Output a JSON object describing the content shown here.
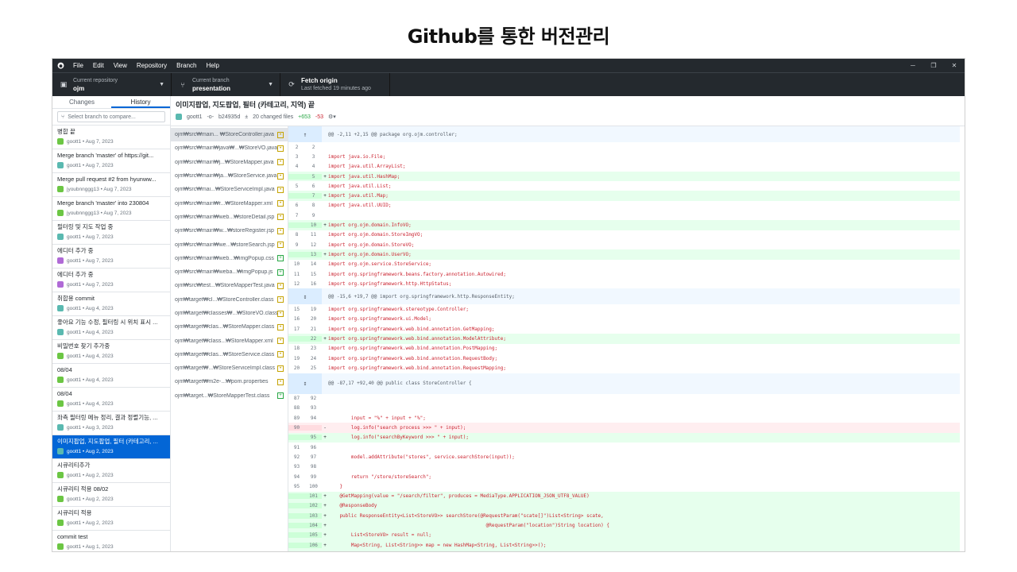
{
  "slide": {
    "title": "Github를 통한 버전관리"
  },
  "menubar": {
    "items": [
      "File",
      "Edit",
      "View",
      "Repository",
      "Branch",
      "Help"
    ],
    "window_controls": [
      "─",
      "❐",
      "✕"
    ]
  },
  "toolbar": {
    "repo_label": "Current repository",
    "repo_value": "ojm",
    "branch_label": "Current branch",
    "branch_value": "presentation",
    "fetch_label": "Fetch origin",
    "fetch_sub": "Last fetched 19 minutes ago"
  },
  "sidebar": {
    "tabs": [
      "Changes",
      "History"
    ],
    "search_placeholder": "Select branch to compare...",
    "commits": [
      {
        "msg": "병합 끝",
        "meta": "goott1 • Aug 7, 2023",
        "av": "green"
      },
      {
        "msg": "Merge branch 'master' of https://git...",
        "meta": "goott1 • Aug 7, 2023",
        "av": "teal"
      },
      {
        "msg": "Merge pull request #2 from hyunww...",
        "meta": "jyoubnnggg13 • Aug 7, 2023",
        "av": "green"
      },
      {
        "msg": "Merge branch 'master' into 230804",
        "meta": "jyoubnnggg13 • Aug 7, 2023",
        "av": "green"
      },
      {
        "msg": "필터링 및 지도 작업 중",
        "meta": "goott1 • Aug 7, 2023",
        "av": "teal"
      },
      {
        "msg": "에디터 추가 중",
        "meta": "goott1 • Aug 7, 2023",
        "av": "purple"
      },
      {
        "msg": "에디터 추가 중",
        "meta": "goott1 • Aug 7, 2023",
        "av": "purple"
      },
      {
        "msg": "취합용 commit",
        "meta": "goott1 • Aug 4, 2023",
        "av": "teal"
      },
      {
        "msg": "좋아요 기능 수정, 필터링 시 위치 표시 ...",
        "meta": "goott1 • Aug 4, 2023",
        "av": "teal"
      },
      {
        "msg": "비밀번호 찾기 추가중",
        "meta": "goott1 • Aug 4, 2023",
        "av": "green"
      },
      {
        "msg": "08/04",
        "meta": "goott1 • Aug 4, 2023",
        "av": "green"
      },
      {
        "msg": "08/04",
        "meta": "goott1 • Aug 4, 2023",
        "av": "green"
      },
      {
        "msg": "좌측 필터링 메뉴 정리, 결과 정렬기능, ...",
        "meta": "goott1 • Aug 3, 2023",
        "av": "teal"
      },
      {
        "msg": "이미지팝업, 지도팝업, 필터 (카테고리, ...",
        "meta": "goott1 • Aug 2, 2023",
        "av": "teal",
        "selected": true
      },
      {
        "msg": "시큐리티추가",
        "meta": "goott1 • Aug 2, 2023",
        "av": "green"
      },
      {
        "msg": "시큐리티 적용 08/02",
        "meta": "goott1 • Aug 2, 2023",
        "av": "green"
      },
      {
        "msg": "시큐리티 적용",
        "meta": "goott1 • Aug 2, 2023",
        "av": "green"
      },
      {
        "msg": "commit test",
        "meta": "goott1 • Aug 1, 2023",
        "av": "green"
      }
    ]
  },
  "commit": {
    "title": "이미지팝업, 지도팝업, 필터 (카테고리, 지역) 끝",
    "author": "goott1",
    "sha": "b24935d",
    "changed": "20 changed files",
    "additions": "+653",
    "deletions": "-53"
  },
  "files": [
    {
      "name": "ojm₩src₩main... ₩StoreController.java",
      "status": "M",
      "selected": true
    },
    {
      "name": "ojm₩src₩main₩java₩...₩StoreVO.java",
      "status": "M"
    },
    {
      "name": "ojm₩src₩main₩j...₩StoreMapper.java",
      "status": "M"
    },
    {
      "name": "ojm₩src₩main₩ja...₩StoreService.java",
      "status": "M"
    },
    {
      "name": "ojm₩src₩mai...₩StoreServiceImpl.java",
      "status": "M"
    },
    {
      "name": "ojm₩src₩main₩r...₩StoreMapper.xml",
      "status": "M"
    },
    {
      "name": "ojm₩src₩main₩web...₩storeDetail.jsp",
      "status": "M"
    },
    {
      "name": "ojm₩src₩main₩w...₩storeRegister.jsp",
      "status": "M"
    },
    {
      "name": "ojm₩src₩main₩we...₩storeSearch.jsp",
      "status": "M"
    },
    {
      "name": "ojm₩src₩main₩web...₩imgPopup.css",
      "status": "A"
    },
    {
      "name": "ojm₩src₩main₩weba...₩imgPopup.js",
      "status": "A"
    },
    {
      "name": "ojm₩src₩test...₩StoreMapperTest.java",
      "status": "M"
    },
    {
      "name": "ojm₩target₩cl...₩StoreController.class",
      "status": "M"
    },
    {
      "name": "ojm₩target₩classes₩...₩StoreVO.class",
      "status": "M"
    },
    {
      "name": "ojm₩target₩clas...₩StoreMapper.class",
      "status": "M"
    },
    {
      "name": "ojm₩target₩class...₩StoreMapper.xml",
      "status": "M"
    },
    {
      "name": "ojm₩target₩clas...₩StoreService.class",
      "status": "M"
    },
    {
      "name": "ojm₩target₩...₩StoreServiceImpl.class",
      "status": "M"
    },
    {
      "name": "ojm₩target₩m2e-...₩pom.properties",
      "status": "M"
    },
    {
      "name": "ojm₩target...₩StoreMapperTest.class",
      "status": "A"
    }
  ],
  "diff": [
    {
      "t": "hunk",
      "code": "@@ -2,11 +2,15 @@ package org.ojm.controller;",
      "icon": "↑"
    },
    {
      "t": "ctx",
      "n1": "2",
      "n2": "2",
      "code": ""
    },
    {
      "t": "ctx",
      "n1": "3",
      "n2": "3",
      "code": "import java.io.File;"
    },
    {
      "t": "ctx",
      "n1": "4",
      "n2": "4",
      "code": "import java.util.ArrayList;"
    },
    {
      "t": "add",
      "n1": "",
      "n2": "5",
      "code": "import java.util.HashMap;"
    },
    {
      "t": "ctx",
      "n1": "5",
      "n2": "6",
      "code": "import java.util.List;"
    },
    {
      "t": "add",
      "n1": "",
      "n2": "7",
      "code": "import java.util.Map;"
    },
    {
      "t": "ctx",
      "n1": "6",
      "n2": "8",
      "code": "import java.util.UUID;"
    },
    {
      "t": "ctx",
      "n1": "7",
      "n2": "9",
      "code": ""
    },
    {
      "t": "add",
      "n1": "",
      "n2": "10",
      "code": "import org.ojm.domain.InfoVO;"
    },
    {
      "t": "ctx",
      "n1": "8",
      "n2": "11",
      "code": "import org.ojm.domain.StoreImgVO;"
    },
    {
      "t": "ctx",
      "n1": "9",
      "n2": "12",
      "code": "import org.ojm.domain.StoreVO;"
    },
    {
      "t": "add",
      "n1": "",
      "n2": "13",
      "code": "import org.ojm.domain.UserVO;"
    },
    {
      "t": "ctx",
      "n1": "10",
      "n2": "14",
      "code": "import org.ojm.service.StoreService;"
    },
    {
      "t": "ctx",
      "n1": "11",
      "n2": "15",
      "code": "import org.springframework.beans.factory.annotation.Autowired;"
    },
    {
      "t": "ctx",
      "n1": "12",
      "n2": "16",
      "code": "import org.springframework.http.HttpStatus;"
    },
    {
      "t": "hunk",
      "code": "@@ -15,6 +19,7 @@ import org.springframework.http.ResponseEntity;",
      "icon": "↕"
    },
    {
      "t": "ctx",
      "n1": "15",
      "n2": "19",
      "code": "import org.springframework.stereotype.Controller;"
    },
    {
      "t": "ctx",
      "n1": "16",
      "n2": "20",
      "code": "import org.springframework.ui.Model;"
    },
    {
      "t": "ctx",
      "n1": "17",
      "n2": "21",
      "code": "import org.springframework.web.bind.annotation.GetMapping;"
    },
    {
      "t": "add",
      "n1": "",
      "n2": "22",
      "code": "import org.springframework.web.bind.annotation.ModelAttribute;"
    },
    {
      "t": "ctx",
      "n1": "18",
      "n2": "23",
      "code": "import org.springframework.web.bind.annotation.PostMapping;"
    },
    {
      "t": "ctx",
      "n1": "19",
      "n2": "24",
      "code": "import org.springframework.web.bind.annotation.RequestBody;"
    },
    {
      "t": "ctx",
      "n1": "20",
      "n2": "25",
      "code": "import org.springframework.web.bind.annotation.RequestMapping;"
    },
    {
      "t": "hunk",
      "code": "@@ -87,17 +92,40 @@ public class StoreController {",
      "icon": "↕",
      "tall": true
    },
    {
      "t": "ctx",
      "n1": "87",
      "n2": "92",
      "code": ""
    },
    {
      "t": "ctx",
      "n1": "88",
      "n2": "93",
      "code": ""
    },
    {
      "t": "ctx",
      "n1": "89",
      "n2": "94",
      "code": "        input = \"%\" + input + \"%\";"
    },
    {
      "t": "del",
      "n1": "90",
      "n2": "",
      "code": "        log.info(\"search process >>> \" + input);"
    },
    {
      "t": "add",
      "n1": "",
      "n2": "95",
      "code": "        log.info(\"searchByKeyword >>> \" + input);"
    },
    {
      "t": "ctx",
      "n1": "91",
      "n2": "96",
      "code": ""
    },
    {
      "t": "ctx",
      "n1": "92",
      "n2": "97",
      "code": "        model.addAttribute(\"stores\", service.searchStore(input));"
    },
    {
      "t": "ctx",
      "n1": "93",
      "n2": "98",
      "code": ""
    },
    {
      "t": "ctx",
      "n1": "94",
      "n2": "99",
      "code": "        return \"/store/storeSearch\";"
    },
    {
      "t": "ctx",
      "n1": "95",
      "n2": "100",
      "code": "    }"
    },
    {
      "t": "add",
      "n1": "",
      "n2": "101",
      "code": "    @GetMapping(value = \"/search/filter\", produces = MediaType.APPLICATION_JSON_UTF8_VALUE)"
    },
    {
      "t": "add",
      "n1": "",
      "n2": "102",
      "code": "    @ResponseBody"
    },
    {
      "t": "add",
      "n1": "",
      "n2": "103",
      "code": "    public ResponseEntity<List<StoreVO>> searchStore(@RequestParam(\"scate[]\")List<String> scate,"
    },
    {
      "t": "add",
      "n1": "",
      "n2": "104",
      "code": "                                                       @RequestParam(\"location\")String location) {"
    },
    {
      "t": "add",
      "n1": "",
      "n2": "105",
      "code": "        List<StoreVO> result = null;"
    },
    {
      "t": "add",
      "n1": "",
      "n2": "106",
      "code": "        Map<String, List<String>> map = new HashMap<String, List<String>>();"
    },
    {
      "t": "add",
      "n1": "",
      "n2": "107",
      "code": "        List<String> loc = new ArrayList<String>();"
    }
  ]
}
